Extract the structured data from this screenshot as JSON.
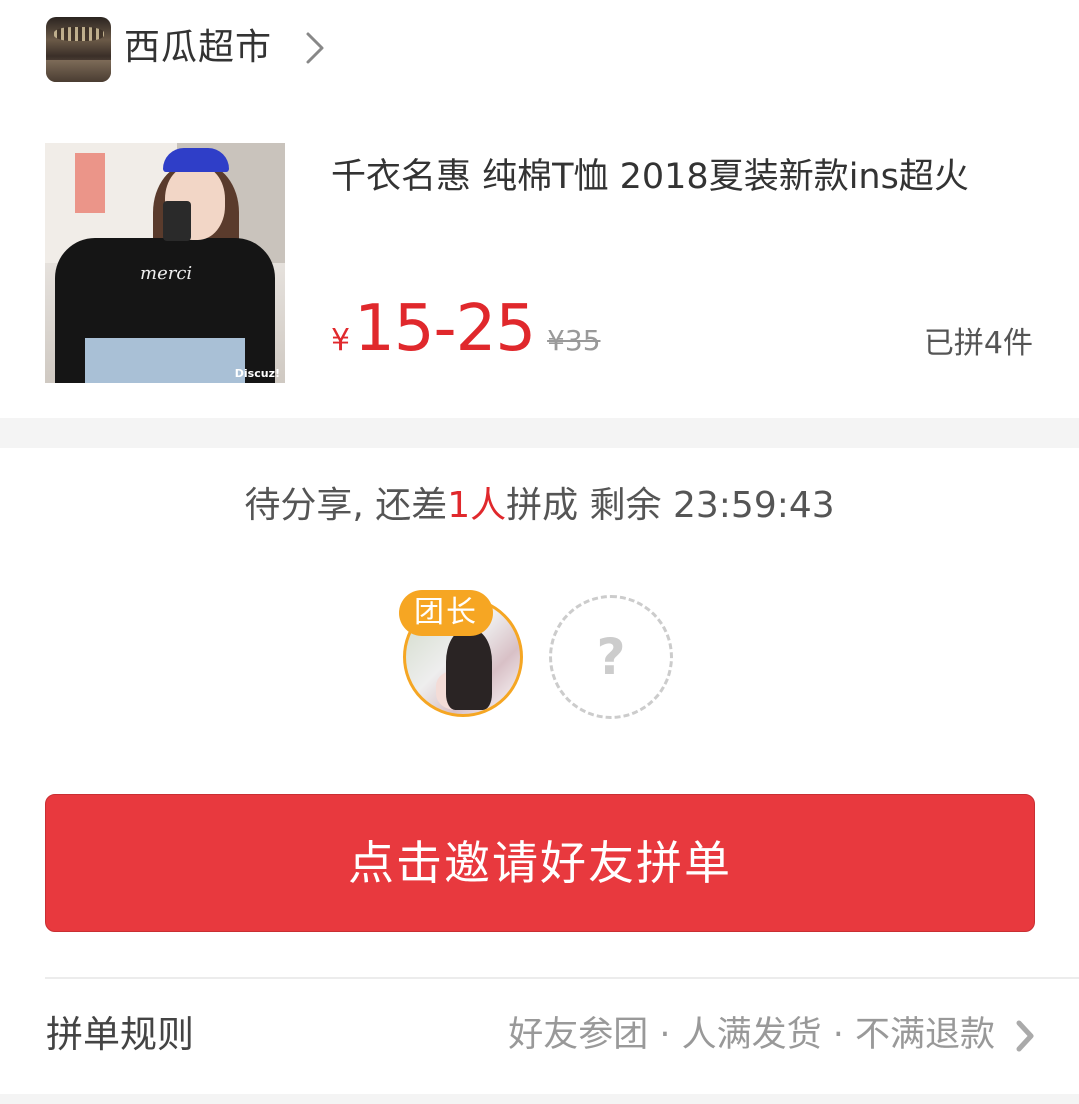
{
  "shop": {
    "name": "西瓜超市"
  },
  "product": {
    "title": "千衣名惠 纯棉T恤 2018夏装新款ins超火",
    "price_currency": "¥",
    "price_range": "15-25",
    "original_price": "¥35",
    "sold": "已拼4件",
    "image_watermark": "Discuz!",
    "image_print": "merci"
  },
  "group": {
    "status_prefix": "待分享, 还差",
    "missing_count": "1人",
    "status_suffix": "拼成 剩余 23:59:43",
    "leader_badge": "团长",
    "empty_slot_symbol": "?"
  },
  "actions": {
    "invite_label": "点击邀请好友拼单"
  },
  "rules": {
    "label": "拼单规则",
    "description": "好友参团 · 人满发货 · 不满退款"
  },
  "colors": {
    "accent_red": "#e8393e",
    "price_red": "#e0282c",
    "leader_orange": "#f6a623"
  },
  "icons": {
    "shop_chevron": "chevron-right-icon",
    "rules_chevron": "chevron-right-icon"
  }
}
